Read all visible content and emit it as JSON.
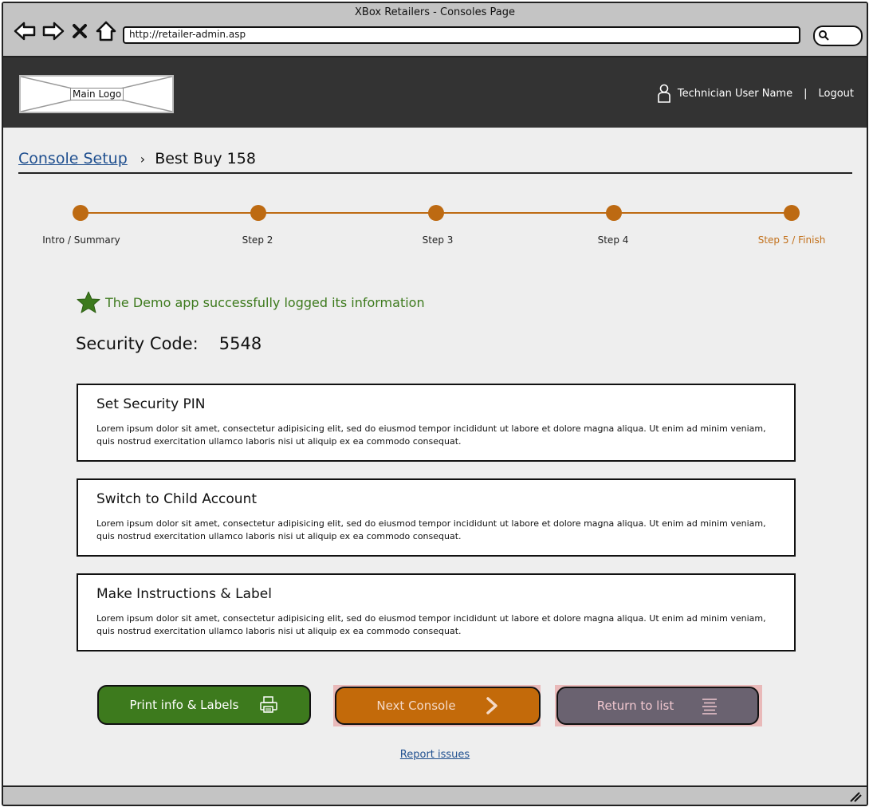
{
  "window": {
    "title": "XBox Retailers - Consoles Page"
  },
  "browser": {
    "url": "http://retailer-admin.asp"
  },
  "header": {
    "logo_label": "Main Logo",
    "user_name": "Technician User Name",
    "separator": "|",
    "logout_label": "Logout"
  },
  "breadcrumb": {
    "parent": "Console Setup",
    "current": "Best Buy 158"
  },
  "stepper": {
    "steps": [
      {
        "label": "Intro / Summary"
      },
      {
        "label": "Step 2"
      },
      {
        "label": "Step 3"
      },
      {
        "label": "Step 4"
      },
      {
        "label": "Step 5 / Finish"
      }
    ],
    "active_step": 5,
    "accent_color": "#bd6a12"
  },
  "status": {
    "success_message": "The Demo app successfully logged its information"
  },
  "security": {
    "label": "Security Code:",
    "code": "5548"
  },
  "cards": [
    {
      "title": "Set Security PIN",
      "body": "Lorem ipsum dolor sit amet, consectetur adipisicing elit, sed do eiusmod tempor incididunt ut labore et dolore magna aliqua. Ut enim ad minim veniam, quis nostrud exercitation ullamco laboris nisi ut aliquip ex ea commodo consequat."
    },
    {
      "title": "Switch to Child Account",
      "body": "Lorem ipsum dolor sit amet, consectetur adipisicing elit, sed do eiusmod tempor incididunt ut labore et dolore magna aliqua. Ut enim ad minim veniam, quis nostrud exercitation ullamco laboris nisi ut aliquip ex ea commodo consequat."
    },
    {
      "title": "Make Instructions & Label",
      "body": "Lorem ipsum dolor sit amet, consectetur adipisicing elit, sed do eiusmod tempor incididunt ut labore et dolore magna aliqua. Ut enim ad minim veniam, quis nostrud exercitation ullamco laboris nisi ut aliquip ex ea commodo consequat."
    }
  ],
  "buttons": {
    "print_label": "Print info & Labels",
    "next_label": "Next Console",
    "return_label": "Return to list"
  },
  "footer": {
    "report_label": "Report issues"
  },
  "colors": {
    "success_green": "#3d7a1d",
    "next_orange": "#c36a0a",
    "return_gray": "#6a6270",
    "link_blue": "#1f4f8f",
    "header_dark": "#333333"
  },
  "icons": [
    "back-icon",
    "forward-icon",
    "stop-icon",
    "home-icon",
    "search-icon",
    "user-icon",
    "star-icon",
    "printer-icon",
    "chevron-right-icon",
    "list-icon",
    "resize-grip-icon"
  ]
}
